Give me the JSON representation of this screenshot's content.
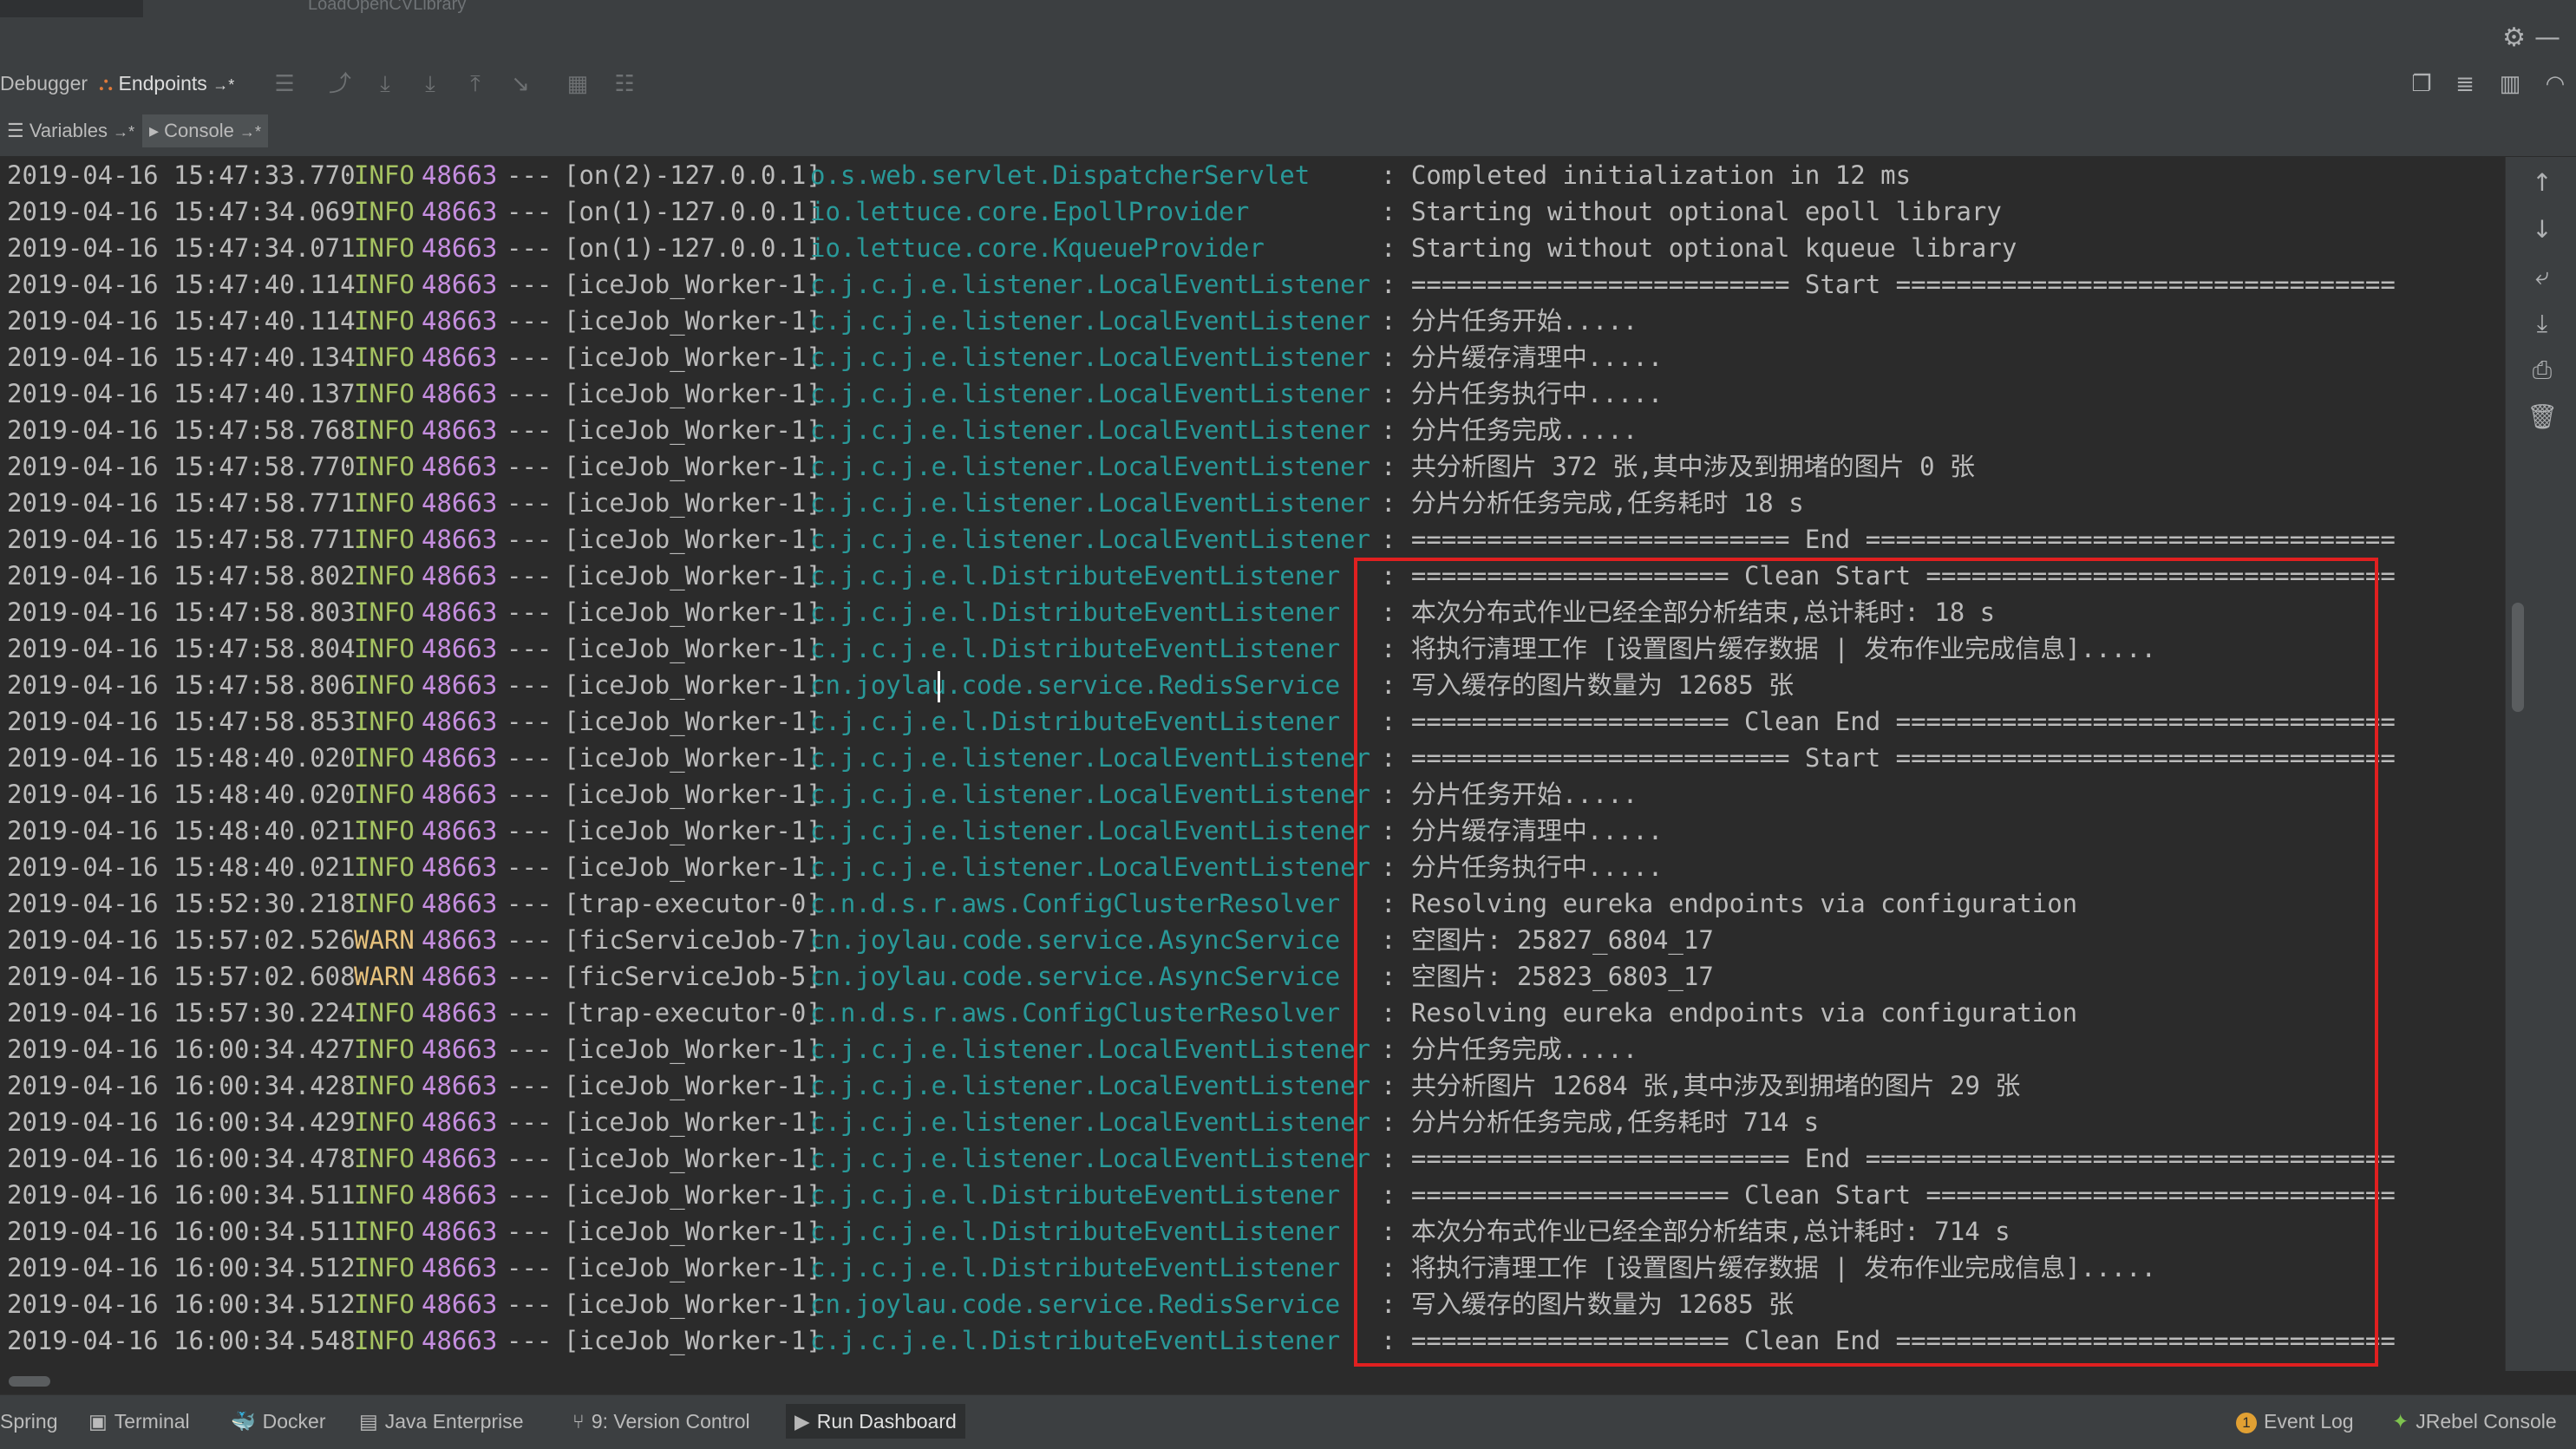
{
  "window": {
    "config_name": "LoadOpenCVLibrary"
  },
  "toolbar": {
    "debugger_tab": "Debugger",
    "endpoints_tab": "Endpoints",
    "pin_glyph": "→*"
  },
  "subtabs": {
    "variables": "Variables",
    "console": "Console",
    "pin_glyph": "→*"
  },
  "icons": {
    "settings": "gear-icon",
    "minimize": "minimize-icon",
    "endpoints": "endpoints-icon",
    "console": "console-icon",
    "variables": "list-icon",
    "restore_layout": "restore-layout-icon",
    "scroll_up": "arrow-up-icon",
    "scroll_down": "arrow-down-icon",
    "soft_wrap": "soft-wrap-icon",
    "scroll_to_end": "scroll-to-end-icon",
    "print": "print-icon",
    "clear": "trash-icon",
    "event_log": "event-log-icon",
    "jrebel": "jrebel-icon"
  },
  "colors": {
    "background": "#2b2b2b",
    "panel": "#3c3f41",
    "info_level": "#a5c261",
    "warn_level": "#e5c07b",
    "pid": "#c58ee0",
    "logger": "#299999",
    "highlight_box": "#e02020",
    "event_badge": "#e1a033"
  },
  "log": {
    "sep": "---",
    "rows": [
      {
        "ts": "2019-04-16 15:47:33.770",
        "level": "INFO",
        "pid": "48663",
        "thread": "[on(2)-127.0.0.1]",
        "logger": "o.s.web.servlet.DispatcherServlet",
        "msg": ": Completed initialization in 12 ms"
      },
      {
        "ts": "2019-04-16 15:47:34.069",
        "level": "INFO",
        "pid": "48663",
        "thread": "[on(1)-127.0.0.1]",
        "logger": "io.lettuce.core.EpollProvider",
        "msg": ": Starting without optional epoll library"
      },
      {
        "ts": "2019-04-16 15:47:34.071",
        "level": "INFO",
        "pid": "48663",
        "thread": "[on(1)-127.0.0.1]",
        "logger": "io.lettuce.core.KqueueProvider",
        "msg": ": Starting without optional kqueue library"
      },
      {
        "ts": "2019-04-16 15:47:40.114",
        "level": "INFO",
        "pid": "48663",
        "thread": "[iceJob_Worker-1]",
        "logger": "c.j.c.j.e.listener.LocalEventListener",
        "msg": ": ========================= Start ================================="
      },
      {
        "ts": "2019-04-16 15:47:40.114",
        "level": "INFO",
        "pid": "48663",
        "thread": "[iceJob_Worker-1]",
        "logger": "c.j.c.j.e.listener.LocalEventListener",
        "msg": ": 分片任务开始....."
      },
      {
        "ts": "2019-04-16 15:47:40.134",
        "level": "INFO",
        "pid": "48663",
        "thread": "[iceJob_Worker-1]",
        "logger": "c.j.c.j.e.listener.LocalEventListener",
        "msg": ": 分片缓存清理中....."
      },
      {
        "ts": "2019-04-16 15:47:40.137",
        "level": "INFO",
        "pid": "48663",
        "thread": "[iceJob_Worker-1]",
        "logger": "c.j.c.j.e.listener.LocalEventListener",
        "msg": ": 分片任务执行中....."
      },
      {
        "ts": "2019-04-16 15:47:58.768",
        "level": "INFO",
        "pid": "48663",
        "thread": "[iceJob_Worker-1]",
        "logger": "c.j.c.j.e.listener.LocalEventListener",
        "msg": ": 分片任务完成....."
      },
      {
        "ts": "2019-04-16 15:47:58.770",
        "level": "INFO",
        "pid": "48663",
        "thread": "[iceJob_Worker-1]",
        "logger": "c.j.c.j.e.listener.LocalEventListener",
        "msg": ": 共分析图片 372 张,其中涉及到拥堵的图片 0 张"
      },
      {
        "ts": "2019-04-16 15:47:58.771",
        "level": "INFO",
        "pid": "48663",
        "thread": "[iceJob_Worker-1]",
        "logger": "c.j.c.j.e.listener.LocalEventListener",
        "msg": ": 分片分析任务完成,任务耗时 18 s"
      },
      {
        "ts": "2019-04-16 15:47:58.771",
        "level": "INFO",
        "pid": "48663",
        "thread": "[iceJob_Worker-1]",
        "logger": "c.j.c.j.e.listener.LocalEventListener",
        "msg": ": ========================= End ==================================="
      },
      {
        "ts": "2019-04-16 15:47:58.802",
        "level": "INFO",
        "pid": "48663",
        "thread": "[iceJob_Worker-1]",
        "logger": "c.j.c.j.e.l.DistributeEventListener",
        "msg": ": ===================== Clean Start ==============================="
      },
      {
        "ts": "2019-04-16 15:47:58.803",
        "level": "INFO",
        "pid": "48663",
        "thread": "[iceJob_Worker-1]",
        "logger": "c.j.c.j.e.l.DistributeEventListener",
        "msg": ": 本次分布式作业已经全部分析结束,总计耗时: 18 s"
      },
      {
        "ts": "2019-04-16 15:47:58.804",
        "level": "INFO",
        "pid": "48663",
        "thread": "[iceJob_Worker-1]",
        "logger": "c.j.c.j.e.l.DistributeEventListener",
        "msg": ": 将执行清理工作 [设置图片缓存数据 | 发布作业完成信息]....."
      },
      {
        "ts": "2019-04-16 15:47:58.806",
        "level": "INFO",
        "pid": "48663",
        "thread": "[iceJob_Worker-1]",
        "logger": "cn.joylau.code.service.RedisService",
        "msg": ": 写入缓存的图片数量为 12685 张"
      },
      {
        "ts": "2019-04-16 15:47:58.853",
        "level": "INFO",
        "pid": "48663",
        "thread": "[iceJob_Worker-1]",
        "logger": "c.j.c.j.e.l.DistributeEventListener",
        "msg": ": ===================== Clean End ================================="
      },
      {
        "ts": "2019-04-16 15:48:40.020",
        "level": "INFO",
        "pid": "48663",
        "thread": "[iceJob_Worker-1]",
        "logger": "c.j.c.j.e.listener.LocalEventListener",
        "msg": ": ========================= Start ================================="
      },
      {
        "ts": "2019-04-16 15:48:40.020",
        "level": "INFO",
        "pid": "48663",
        "thread": "[iceJob_Worker-1]",
        "logger": "c.j.c.j.e.listener.LocalEventListener",
        "msg": ": 分片任务开始....."
      },
      {
        "ts": "2019-04-16 15:48:40.021",
        "level": "INFO",
        "pid": "48663",
        "thread": "[iceJob_Worker-1]",
        "logger": "c.j.c.j.e.listener.LocalEventListener",
        "msg": ": 分片缓存清理中....."
      },
      {
        "ts": "2019-04-16 15:48:40.021",
        "level": "INFO",
        "pid": "48663",
        "thread": "[iceJob_Worker-1]",
        "logger": "c.j.c.j.e.listener.LocalEventListener",
        "msg": ": 分片任务执行中....."
      },
      {
        "ts": "2019-04-16 15:52:30.218",
        "level": "INFO",
        "pid": "48663",
        "thread": "[trap-executor-0]",
        "logger": "c.n.d.s.r.aws.ConfigClusterResolver",
        "msg": ": Resolving eureka endpoints via configuration"
      },
      {
        "ts": "2019-04-16 15:57:02.526",
        "level": "WARN",
        "pid": "48663",
        "thread": "[ficServiceJob-7]",
        "logger": "cn.joylau.code.service.AsyncService",
        "msg": ": 空图片: 25827_6804_17"
      },
      {
        "ts": "2019-04-16 15:57:02.608",
        "level": "WARN",
        "pid": "48663",
        "thread": "[ficServiceJob-5]",
        "logger": "cn.joylau.code.service.AsyncService",
        "msg": ": 空图片: 25823_6803_17"
      },
      {
        "ts": "2019-04-16 15:57:30.224",
        "level": "INFO",
        "pid": "48663",
        "thread": "[trap-executor-0]",
        "logger": "c.n.d.s.r.aws.ConfigClusterResolver",
        "msg": ": Resolving eureka endpoints via configuration"
      },
      {
        "ts": "2019-04-16 16:00:34.427",
        "level": "INFO",
        "pid": "48663",
        "thread": "[iceJob_Worker-1]",
        "logger": "c.j.c.j.e.listener.LocalEventListener",
        "msg": ": 分片任务完成....."
      },
      {
        "ts": "2019-04-16 16:00:34.428",
        "level": "INFO",
        "pid": "48663",
        "thread": "[iceJob_Worker-1]",
        "logger": "c.j.c.j.e.listener.LocalEventListener",
        "msg": ": 共分析图片 12684 张,其中涉及到拥堵的图片 29 张"
      },
      {
        "ts": "2019-04-16 16:00:34.429",
        "level": "INFO",
        "pid": "48663",
        "thread": "[iceJob_Worker-1]",
        "logger": "c.j.c.j.e.listener.LocalEventListener",
        "msg": ": 分片分析任务完成,任务耗时 714 s"
      },
      {
        "ts": "2019-04-16 16:00:34.478",
        "level": "INFO",
        "pid": "48663",
        "thread": "[iceJob_Worker-1]",
        "logger": "c.j.c.j.e.listener.LocalEventListener",
        "msg": ": ========================= End ==================================="
      },
      {
        "ts": "2019-04-16 16:00:34.511",
        "level": "INFO",
        "pid": "48663",
        "thread": "[iceJob_Worker-1]",
        "logger": "c.j.c.j.e.l.DistributeEventListener",
        "msg": ": ===================== Clean Start ==============================="
      },
      {
        "ts": "2019-04-16 16:00:34.511",
        "level": "INFO",
        "pid": "48663",
        "thread": "[iceJob_Worker-1]",
        "logger": "c.j.c.j.e.l.DistributeEventListener",
        "msg": ": 本次分布式作业已经全部分析结束,总计耗时: 714 s"
      },
      {
        "ts": "2019-04-16 16:00:34.512",
        "level": "INFO",
        "pid": "48663",
        "thread": "[iceJob_Worker-1]",
        "logger": "c.j.c.j.e.l.DistributeEventListener",
        "msg": ": 将执行清理工作 [设置图片缓存数据 | 发布作业完成信息]....."
      },
      {
        "ts": "2019-04-16 16:00:34.512",
        "level": "INFO",
        "pid": "48663",
        "thread": "[iceJob_Worker-1]",
        "logger": "cn.joylau.code.service.RedisService",
        "msg": ": 写入缓存的图片数量为 12685 张"
      },
      {
        "ts": "2019-04-16 16:00:34.548",
        "level": "INFO",
        "pid": "48663",
        "thread": "[iceJob_Worker-1]",
        "logger": "c.j.c.j.e.l.DistributeEventListener",
        "msg": ": ===================== Clean End ================================="
      }
    ]
  },
  "statusbar": {
    "spring": "Spring",
    "terminal": "Terminal",
    "docker": "Docker",
    "java_enterprise": "Java Enterprise",
    "version_control": "9: Version Control",
    "run_dashboard": "Run Dashboard",
    "event_log": "Event Log",
    "event_count": "1",
    "jrebel": "JRebel Console"
  }
}
